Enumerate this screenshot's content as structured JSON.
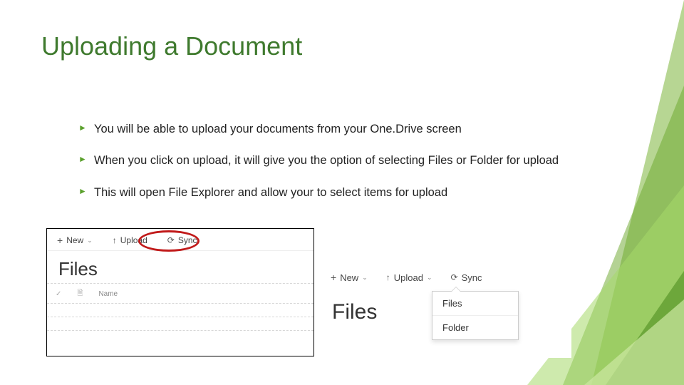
{
  "title": "Uploading a Document",
  "bullets": [
    "You will be able to upload your documents from your One.Drive screen",
    "When you click on upload, it will give you the option of selecting Files or Folder for upload",
    "This will open File Explorer and allow your to select items for upload"
  ],
  "panel1": {
    "new": "New",
    "upload": "Upload",
    "sync": "Sync",
    "files": "Files",
    "name_col": "Name"
  },
  "panel2": {
    "new": "New",
    "upload": "Upload",
    "sync": "Sync",
    "files": "Files",
    "dd_files": "Files",
    "dd_folder": "Folder"
  }
}
